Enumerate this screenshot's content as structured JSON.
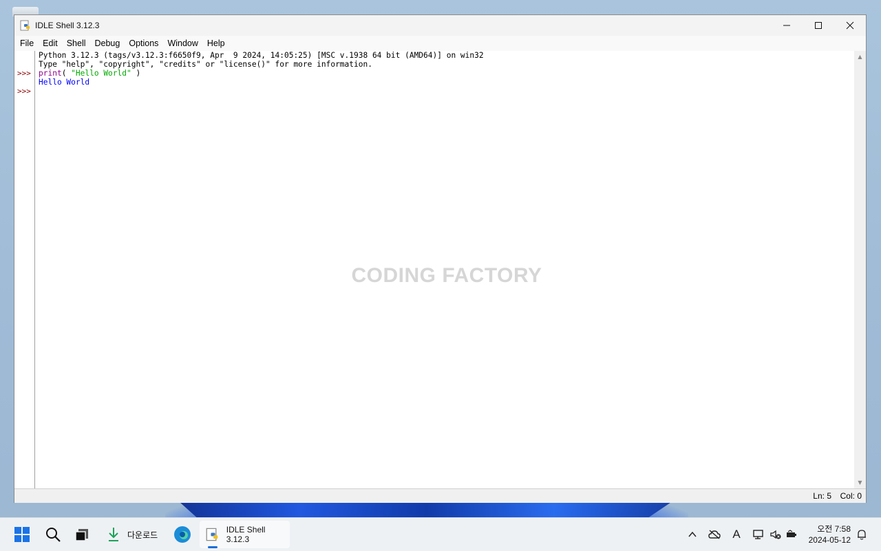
{
  "window": {
    "title": "IDLE Shell 3.12.3",
    "controls": {
      "minimize": "—",
      "maximize": "☐",
      "close": "✕"
    }
  },
  "menubar": {
    "items": [
      "File",
      "Edit",
      "Shell",
      "Debug",
      "Options",
      "Window",
      "Help"
    ]
  },
  "shell": {
    "banner_line1": "Python 3.12.3 (tags/v3.12.3:f6650f9, Apr  9 2024, 14:05:25) [MSC v.1938 64 bit (AMD64)] on win32",
    "banner_line2": "Type \"help\", \"copyright\", \"credits\" or \"license()\" for more information.",
    "prompt": ">>>",
    "input_func": "print",
    "input_open": "( ",
    "input_string": "\"Hello World\"",
    "input_close": " )",
    "output": "Hello World",
    "colors": {
      "prompt": "#8b0000",
      "builtin": "#900090",
      "string": "#00aa00",
      "output": "#0000ff"
    }
  },
  "watermark": "CODING FACTORY",
  "statusbar": {
    "ln": "Ln: 5",
    "col": "Col: 0"
  },
  "taskbar": {
    "downloads_label": "다운로드",
    "idle_label": "IDLE Shell 3.12.3",
    "clock_time": "오전 7:58",
    "clock_date": "2024-05-12",
    "tray_font_glyph": "A"
  }
}
